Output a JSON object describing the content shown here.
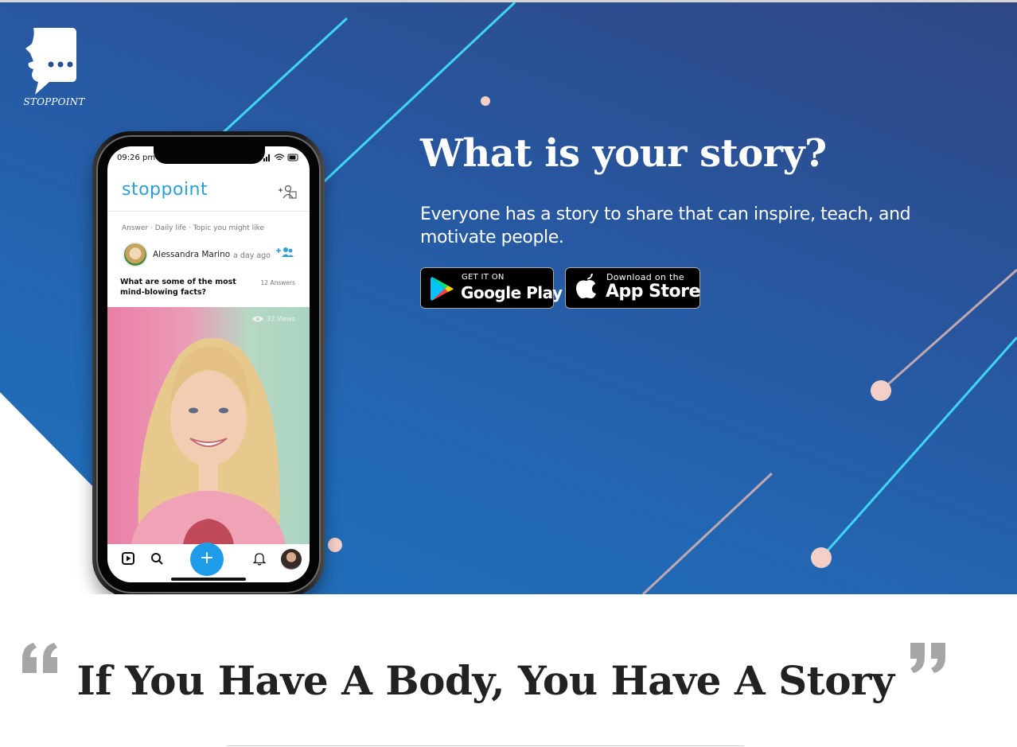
{
  "brand": {
    "logo_text": "STOPPOINT"
  },
  "hero": {
    "title": "What is your story?",
    "subtitle": "Everyone has a story to share that can inspire, teach, and motivate people."
  },
  "stores": {
    "google": {
      "small": "GET IT ON",
      "big": "Google Play"
    },
    "apple": {
      "small": "Download on the",
      "big": "App Store"
    }
  },
  "phone": {
    "time": "09:26 pm",
    "app_name": "stoppoint",
    "post_meta": "Answer · Daily life · Topic you might like",
    "author": "Alessandra Marino",
    "posted": "a day ago",
    "question": "What are some of the most mind-blowing facts?",
    "answers": "12 Answers",
    "views": "32 Views",
    "fab": "+"
  },
  "quote": {
    "text": "If You Have A Body, You Have A Story",
    "open_mark": "“",
    "close_mark": "”"
  },
  "colors": {
    "accent_cyan": "#3fd6f5",
    "accent_pink": "#f4cfc8",
    "accent_mauve": "#c0a8b0",
    "fab_blue": "#1e9ce9",
    "brand_blue": "#2b9fd6"
  }
}
